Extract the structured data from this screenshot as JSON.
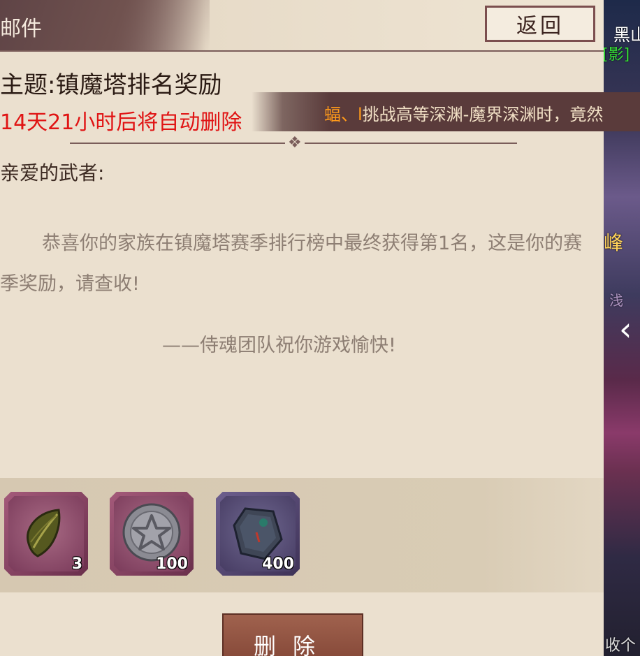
{
  "header": {
    "title": "邮件",
    "back_label": "返回"
  },
  "mail": {
    "subject": "主题:镇魔塔排名奖励",
    "expiry": "14天21小时后将自动删除",
    "greeting": "亲爱的武者:",
    "body": "恭喜你的家族在镇魔塔赛季排行榜中最终获得第1名，这是你的赛季奖励，请查收!",
    "signature": "——侍魂团队祝你游戏愉快!"
  },
  "marquee": {
    "prefix": "蝠、",
    "mark": "l",
    "text": "挑战高等深渊-魔界深渊时，竟然"
  },
  "attachments": [
    {
      "icon": "leaf-material-icon",
      "quantity": "3"
    },
    {
      "icon": "star-coin-icon",
      "quantity": "100"
    },
    {
      "icon": "jade-token-icon",
      "quantity": "400"
    }
  ],
  "actions": {
    "delete_label": "删除"
  },
  "scene": {
    "texts": [
      "黑山",
      "[影]",
      "峰",
      "浅",
      "收个"
    ]
  },
  "colors": {
    "accent": "#854838",
    "expiry": "#e01414",
    "panel": "#ebe0cf"
  }
}
